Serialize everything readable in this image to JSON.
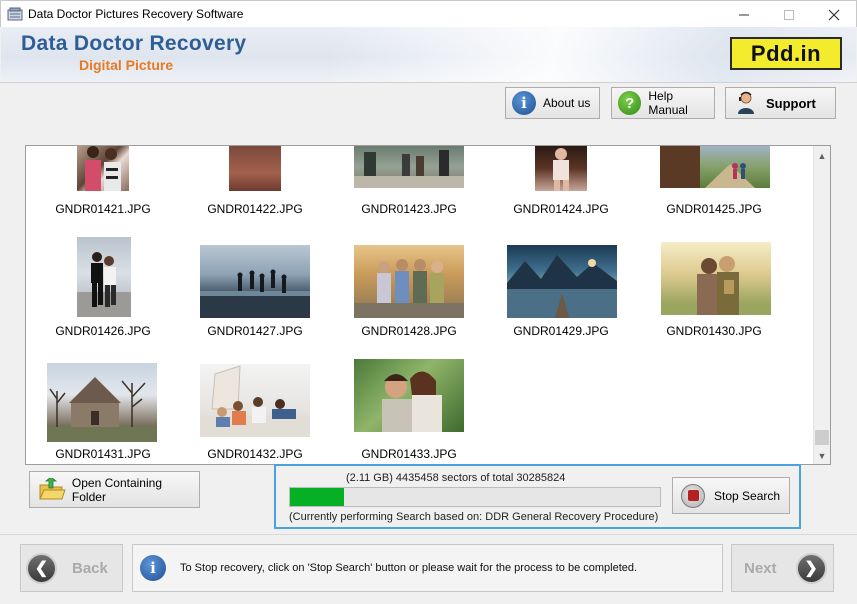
{
  "window": {
    "title": "Data Doctor Pictures Recovery Software",
    "minimize_icon": "minimize-icon",
    "maximize_icon": "maximize-icon",
    "close_icon": "close-icon"
  },
  "banner": {
    "brand_line1": "Data Doctor Recovery",
    "brand_line2": "Digital Picture",
    "logo_text": "Pdd.in",
    "accent_blue": "#2f5d95",
    "accent_orange": "#e87a22",
    "logo_bg": "#f3ec2d"
  },
  "toolbar": {
    "about_label": "About us",
    "help_label": "Help Manual",
    "support_label": "Support"
  },
  "files": [
    {
      "name": "GNDR01421.JPG"
    },
    {
      "name": "GNDR01422.JPG"
    },
    {
      "name": "GNDR01423.JPG"
    },
    {
      "name": "GNDR01424.JPG"
    },
    {
      "name": "GNDR01425.JPG"
    },
    {
      "name": "GNDR01426.JPG"
    },
    {
      "name": "GNDR01427.JPG"
    },
    {
      "name": "GNDR01428.JPG"
    },
    {
      "name": "GNDR01429.JPG"
    },
    {
      "name": "GNDR01430.JPG"
    },
    {
      "name": "GNDR01431.JPG"
    },
    {
      "name": "GNDR01432.JPG"
    },
    {
      "name": "GNDR01433.JPG"
    }
  ],
  "actions": {
    "open_folder_label": "Open Containing Folder"
  },
  "progress": {
    "sectors_text": "(2.11 GB) 4435458   sectors  of  total 30285824",
    "performing_text": "(Currently performing Search based on:  DDR General Recovery Procedure)",
    "stop_label": "Stop Search",
    "fraction": 0.146
  },
  "footer": {
    "back_label": "Back",
    "next_label": "Next",
    "status_message": "To Stop recovery, click on 'Stop Search' button or please wait for the process to be completed."
  }
}
